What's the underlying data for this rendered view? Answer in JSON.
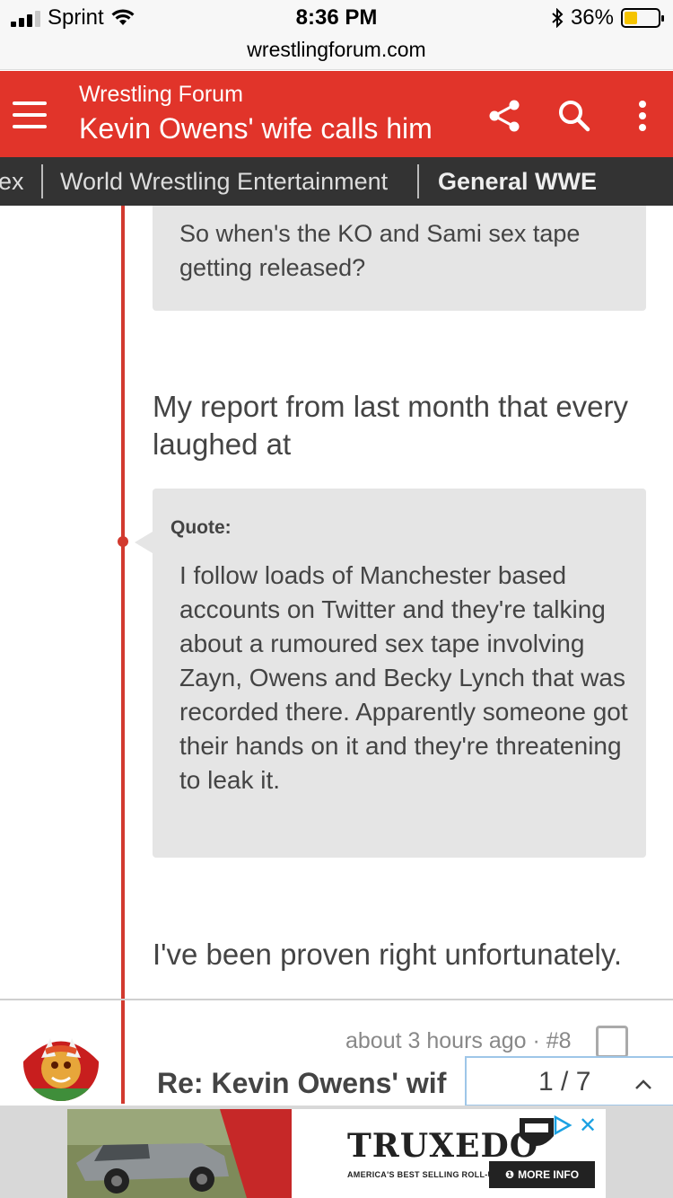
{
  "status": {
    "carrier": "Sprint",
    "time": "8:36 PM",
    "battery": "36%"
  },
  "browser": {
    "url": "wrestlingforum.com"
  },
  "header": {
    "site": "Wrestling Forum",
    "title": "Kevin Owens' wife calls him"
  },
  "breadcrumbs": [
    "ex",
    "World Wrestling Entertainment",
    "General WWE"
  ],
  "post": {
    "quote_top": "So when's the KO and Sami sex tape getting released?",
    "text1": "My report from last month that every laughed at",
    "quote_label": "Quote:",
    "quote_body": "I follow loads of Manchester based accounts on Twitter and they're talking about a rumoured sex tape involving Zayn, Owens and Becky Lynch that was recorded there. Apparently someone got their hands on it and they're threatening to leak it.",
    "text2": "I've been proven right unfortunately."
  },
  "next_post": {
    "meta": "about 3 hours ago · #8",
    "title": "Re: Kevin Owens' wif"
  },
  "pager": {
    "count": "1 / 7"
  },
  "ad": {
    "brand": "TRUXEDO",
    "tagline": "AMERICA'S BEST SELLING ROLL-UP COVERS",
    "more": "MORE INFO"
  }
}
